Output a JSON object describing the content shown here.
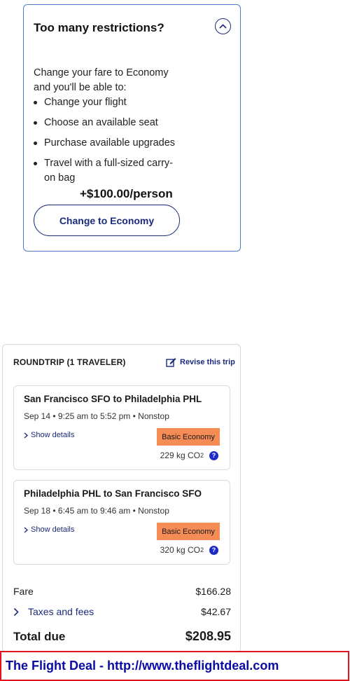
{
  "upsell": {
    "title": "Too many restrictions?",
    "intro": "Change your fare to Economy and you'll be able to:",
    "benefits": [
      "Change your flight",
      "Choose an available seat",
      "Purchase available upgrades",
      "Travel with a full-sized carry-on bag"
    ],
    "price": "+$100.00/person",
    "button_label": "Change to Economy",
    "collapse_icon": "chevron-up-icon"
  },
  "summary": {
    "title": "ROUNDTRIP (1 TRAVELER)",
    "revise_label": "Revise this trip",
    "flights": [
      {
        "route": "San Francisco SFO to Philadelphia PHL",
        "times": "Sep 14 • 9:25 am to 5:52 pm • Nonstop",
        "details_label": "Show details",
        "fare_class": "Basic Economy",
        "co2_value": "229 kg CO",
        "co2_sub": "2"
      },
      {
        "route": "Philadelphia PHL to San Francisco SFO",
        "times": "Sep 18 • 6:45 am to 9:46 am • Nonstop",
        "details_label": "Show details",
        "fare_class": "Basic Economy",
        "co2_value": "320 kg CO",
        "co2_sub": "2"
      }
    ],
    "fare_label": "Fare",
    "fare_amount": "$166.28",
    "taxes_label": "Taxes and fees",
    "taxes_amount": "$42.67",
    "total_label": "Total due",
    "total_amount": "$208.95"
  },
  "banner": {
    "text": "The Flight Deal - http://www.theflightdeal.com"
  },
  "colors": {
    "accent": "#1b2a7a",
    "badge": "#f58b55",
    "info": "#1b2ac8",
    "banner_border": "#e0141e",
    "banner_text": "#0a0aa5"
  }
}
